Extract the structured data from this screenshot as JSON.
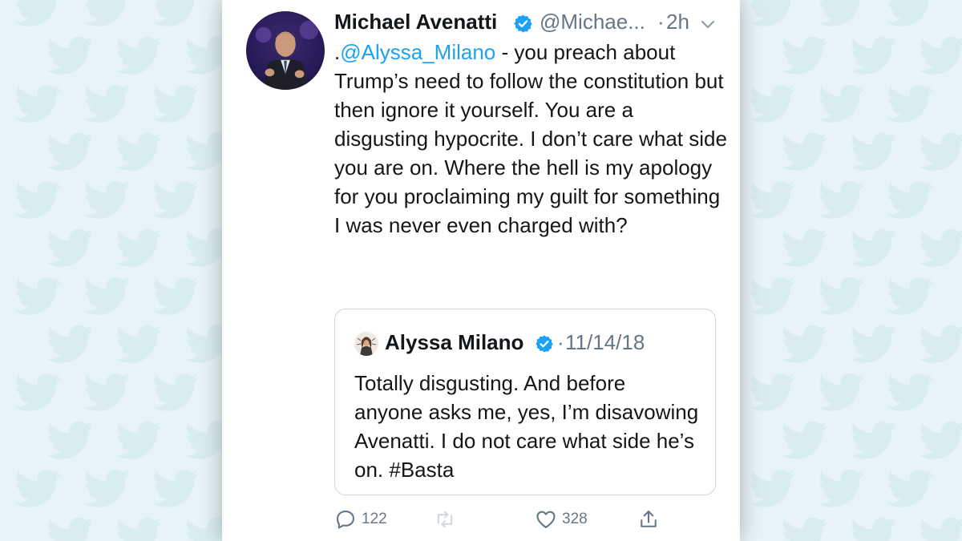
{
  "tweet": {
    "author_name": "Michael Avenatti",
    "handle": "@Michae...",
    "dot": "·",
    "time": "2h",
    "text_prefix": ".",
    "mention": "@Alyssa_Milano",
    "text": " - you preach about Trump’s need to follow the constitution but then ignore it yourself. You are a disgusting hypocrite. I don’t care what side you are on. Where the hell is my apology for you proclaiming my guilt for something I was never even charged with?"
  },
  "quoted_tweet": {
    "author_name": "Alyssa Milano",
    "dot": "·",
    "date": "11/14/18",
    "text": "Totally disgusting. And before anyone asks me, yes, I’m disavowing Avenatti. I do not care what side he’s on. #Basta"
  },
  "actions": {
    "reply_count": "122",
    "retweet_count": "",
    "like_count": "328"
  },
  "colors": {
    "background": "#e7f3f6",
    "bird": "#cfe9ee",
    "link": "#1da1f2",
    "verified": "#1da1f2",
    "secondary_text": "#657786",
    "icon": "#657786",
    "retweet_icon_disabled": "#cfd9de"
  },
  "icons": [
    "twitter-bird-icon",
    "verified-badge-icon",
    "chevron-down-icon",
    "reply-icon",
    "retweet-icon",
    "like-icon",
    "share-icon"
  ]
}
